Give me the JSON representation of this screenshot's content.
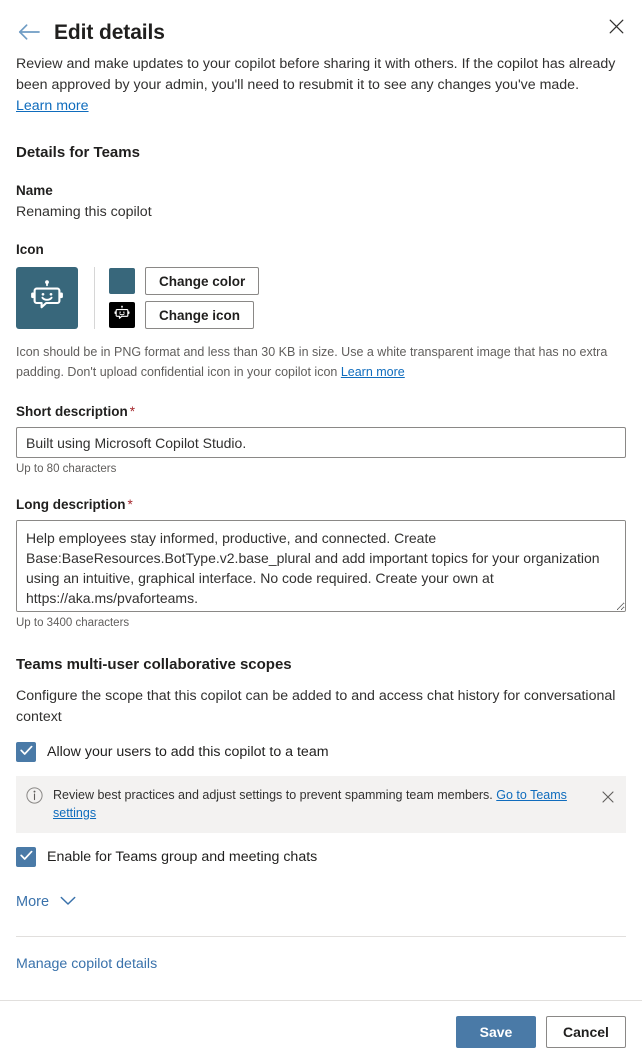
{
  "header": {
    "title": "Edit details",
    "back_icon": "arrow-left-icon",
    "close_icon": "close-icon"
  },
  "intro": {
    "text": "Review and make updates to your copilot before sharing it with others. If the copilot has already been approved by your admin, you'll need to resubmit it to see any changes you've made. ",
    "link_label": "Learn more"
  },
  "details_section": {
    "title": "Details for Teams",
    "name": {
      "label": "Name",
      "value": "Renaming this copilot"
    },
    "icon": {
      "label": "Icon",
      "tile_color": "#38677b",
      "swatch_color": "#38677b",
      "icon_swatch_bg": "#000000",
      "change_color_label": "Change color",
      "change_icon_label": "Change icon",
      "hint": "Icon should be in PNG format and less than 30 KB in size. Use a white transparent image that has no extra padding. Don't upload confidential icon in your copilot icon ",
      "hint_link_label": "Learn more"
    },
    "short_description": {
      "label": "Short description",
      "required_marker": "*",
      "value": "Built using Microsoft Copilot Studio.",
      "helper": "Up to 80 characters"
    },
    "long_description": {
      "label": "Long description",
      "required_marker": "*",
      "value": "Help employees stay informed, productive, and connected. Create Base:BaseResources.BotType.v2.base_plural and add important topics for your organization using an intuitive, graphical interface. No code required. Create your own at https://aka.ms/pvaforteams.",
      "helper": "Up to 3400 characters"
    }
  },
  "scopes_section": {
    "title": "Teams multi-user collaborative scopes",
    "description": "Configure the scope that this copilot can be added to and access chat history for conversational context",
    "checkbox_add_to_team": {
      "label": "Allow your users to add this copilot to a team",
      "checked": true
    },
    "message_bar": {
      "icon": "info-icon",
      "text": "Review best practices and adjust settings to prevent spamming team members. ",
      "link_label": "Go to Teams settings",
      "close_icon": "close-icon"
    },
    "checkbox_group_chats": {
      "label": "Enable for Teams group and meeting chats",
      "checked": true
    },
    "more_toggle": {
      "label": "More",
      "icon": "chevron-down-icon"
    }
  },
  "manage_link": {
    "label": "Manage copilot details"
  },
  "footer": {
    "save_label": "Save",
    "cancel_label": "Cancel"
  },
  "colors": {
    "accent_blue": "#4a7aa7",
    "link_blue": "#0f6cbd",
    "required_red": "#a4262c",
    "teal_tile": "#38677b"
  }
}
